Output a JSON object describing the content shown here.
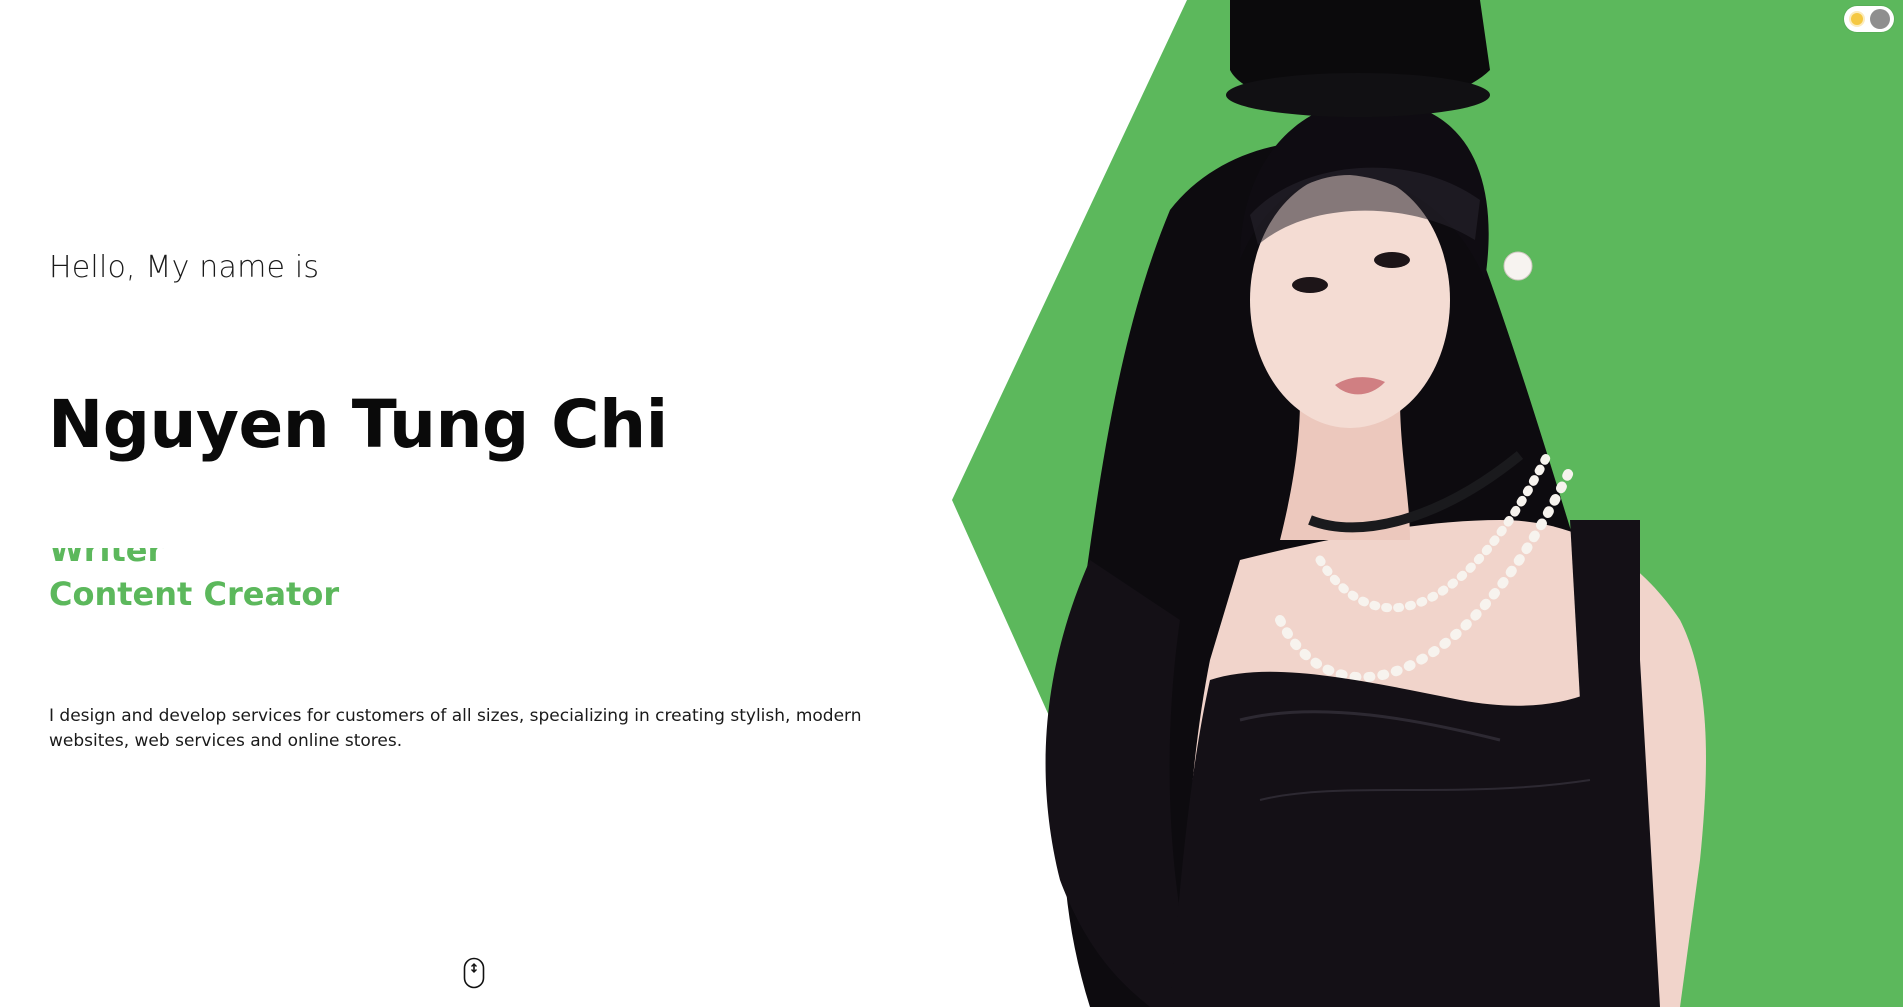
{
  "hero": {
    "greeting": "Hello, My name is",
    "name": "Nguyen Tung Chi",
    "roles": [
      "Writer",
      "Content Creator"
    ],
    "description": "I design and develop services for customers of all sizes, specializing in creating stylish, modern websites, web services and online stores."
  },
  "theme_toggle": {
    "mode": "light",
    "icon": "sun-icon"
  },
  "scroll_indicator": {
    "icon": "mouse-scroll-icon"
  },
  "colors": {
    "accent": "#5cb85c",
    "background": "#ffffff",
    "text": "#0b0b0b",
    "toggle_knob": "#8e8e8e"
  }
}
